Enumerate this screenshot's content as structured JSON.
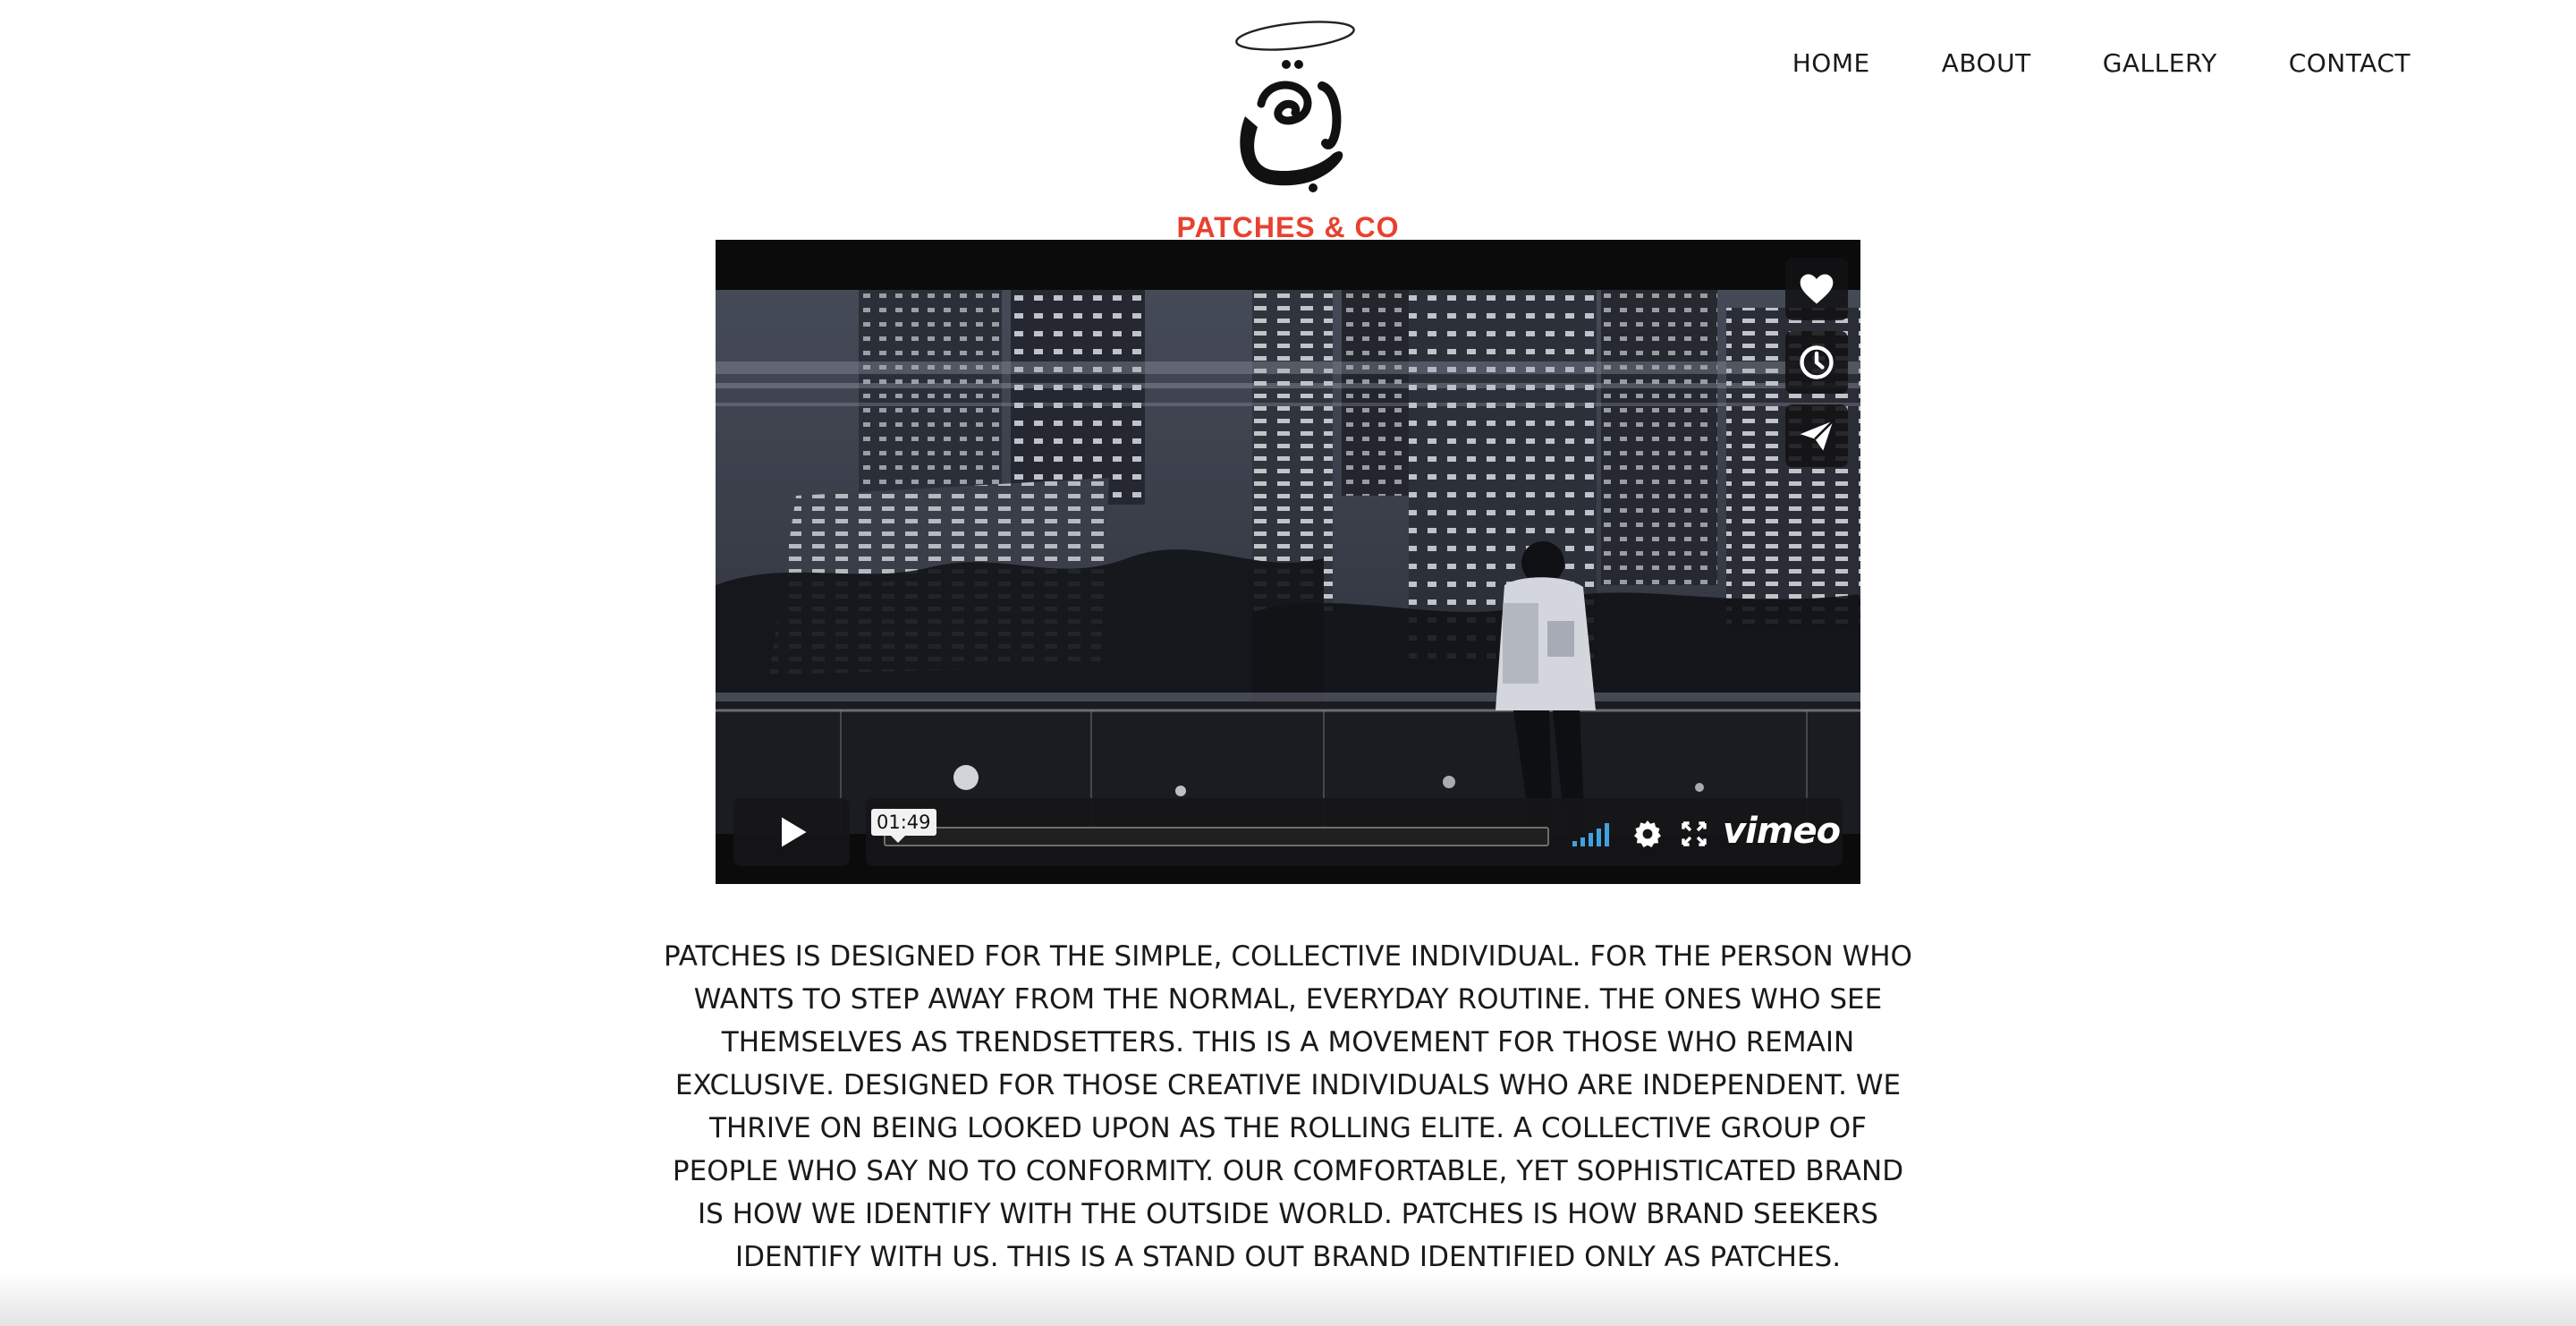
{
  "brand": {
    "logo_icon": "arabic-calligraphy-logo-icon",
    "name": "PATCHES & CO",
    "name_color": "#e8412f"
  },
  "nav": {
    "items": [
      {
        "label": "HOME"
      },
      {
        "label": "ABOUT"
      },
      {
        "label": "GALLERY"
      },
      {
        "label": "CONTACT"
      }
    ]
  },
  "video": {
    "player_brand": "vimeo",
    "tooltip_time": "01:49",
    "progress_fraction": 0.0,
    "side_actions": [
      {
        "icon": "heart-icon"
      },
      {
        "icon": "clock-icon"
      },
      {
        "icon": "paper-plane-icon"
      }
    ],
    "control_icons": [
      "play-icon",
      "volume-icon",
      "settings-icon",
      "fullscreen-icon"
    ],
    "volume_color": "#3fa2e0"
  },
  "description": {
    "text": "PATCHES IS DESIGNED FOR THE SIMPLE, COLLECTIVE INDIVIDUAL. FOR THE PERSON WHO WANTS TO STEP AWAY FROM THE NORMAL, EVERYDAY ROUTINE. THE ONES WHO SEE THEMSELVES AS TRENDSETTERS. THIS IS A MOVEMENT FOR THOSE WHO REMAIN EXCLUSIVE. DESIGNED FOR THOSE CREATIVE INDIVIDUALS WHO ARE INDEPENDENT. WE THRIVE ON BEING LOOKED UPON AS THE ROLLING ELITE. A COLLECTIVE GROUP OF PEOPLE WHO SAY NO TO CONFORMITY. OUR COMFORTABLE, YET SOPHISTICATED BRAND IS HOW WE IDENTIFY WITH THE OUTSIDE WORLD. PATCHES IS HOW BRAND SEEKERS IDENTIFY WITH US. THIS IS A STAND OUT BRAND IDENTIFIED ONLY AS PATCHES."
  }
}
